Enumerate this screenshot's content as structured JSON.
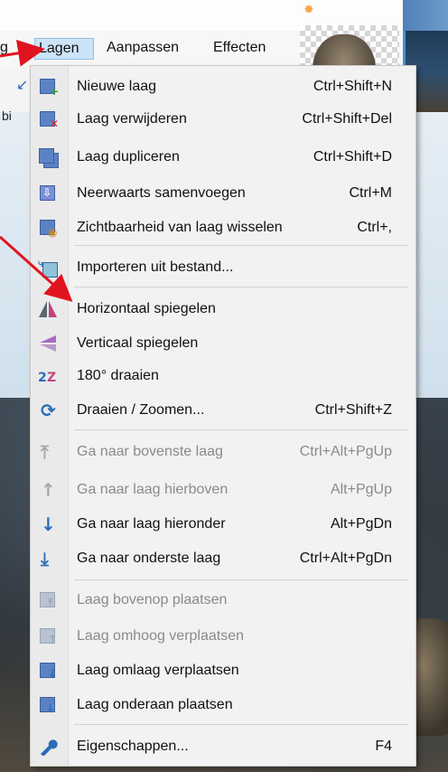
{
  "menubar": {
    "fragment_left": "g",
    "lagen": "Lagen",
    "aanpassen": "Aanpassen",
    "effecten": "Effecten"
  },
  "toolbar": {
    "text_fragment": "bi"
  },
  "colors": {
    "accent": "#2b6cb8",
    "annotation_arrow": "#e0141e",
    "menu_highlight": "#cce4f7"
  },
  "menu": {
    "new_layer": {
      "label": "Nieuwe laag",
      "shortcut": "Ctrl+Shift+N",
      "icon": "new-layer-icon"
    },
    "delete_layer": {
      "label": "Laag verwijderen",
      "shortcut": "Ctrl+Shift+Del",
      "icon": "delete-layer-icon"
    },
    "duplicate_layer": {
      "label": "Laag dupliceren",
      "shortcut": "Ctrl+Shift+D",
      "icon": "duplicate-layer-icon"
    },
    "merge_down": {
      "label": "Neerwaarts samenvoegen",
      "shortcut": "Ctrl+M",
      "icon": "merge-down-icon"
    },
    "toggle_visibility": {
      "label": "Zichtbaarheid van laag wisselen",
      "shortcut": "Ctrl+,",
      "icon": "visibility-icon"
    },
    "import_file": {
      "label": "Importeren uit bestand...",
      "shortcut": "",
      "icon": "import-icon"
    },
    "flip_horizontal": {
      "label": "Horizontaal spiegelen",
      "shortcut": "",
      "icon": "flip-horizontal-icon"
    },
    "flip_vertical": {
      "label": "Verticaal spiegelen",
      "shortcut": "",
      "icon": "flip-vertical-icon"
    },
    "rotate_180": {
      "label": "180° draaien",
      "shortcut": "",
      "icon": "rotate-180-icon"
    },
    "rotate_zoom": {
      "label": "Draaien / Zoomen...",
      "shortcut": "Ctrl+Shift+Z",
      "icon": "rotate-zoom-icon"
    },
    "go_top": {
      "label": "Ga naar bovenste laag",
      "shortcut": "Ctrl+Alt+PgUp",
      "icon": "go-top-icon",
      "disabled": true
    },
    "go_above": {
      "label": "Ga naar laag hierboven",
      "shortcut": "Alt+PgUp",
      "icon": "go-up-icon",
      "disabled": true
    },
    "go_below": {
      "label": "Ga naar laag hieronder",
      "shortcut": "Alt+PgDn",
      "icon": "go-down-icon"
    },
    "go_bottom": {
      "label": "Ga naar onderste laag",
      "shortcut": "Ctrl+Alt+PgDn",
      "icon": "go-bottom-icon"
    },
    "move_to_top": {
      "label": "Laag bovenop plaatsen",
      "shortcut": "",
      "icon": "move-to-top-icon",
      "disabled": true
    },
    "move_up": {
      "label": "Laag omhoog verplaatsen",
      "shortcut": "",
      "icon": "move-up-icon",
      "disabled": true
    },
    "move_down": {
      "label": "Laag omlaag verplaatsen",
      "shortcut": "",
      "icon": "move-down-icon"
    },
    "move_to_bottom": {
      "label": "Laag onderaan plaatsen",
      "shortcut": "",
      "icon": "move-to-bottom-icon"
    },
    "properties": {
      "label": "Eigenschappen...",
      "shortcut": "F4",
      "icon": "wrench-icon"
    }
  }
}
